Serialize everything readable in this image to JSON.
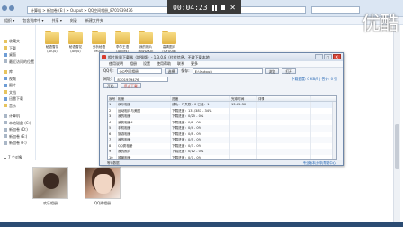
{
  "recorder": {
    "time": "00:04:23"
  },
  "watermark": "优酷",
  "explorer": {
    "address": "计算机 > 新加卷 (E:) > Output > QQ空间相册_8701939476",
    "search_placeholder": "",
    "toolbar": [
      "组织 ▾",
      "包含到库中 ▾",
      "共享 ▾",
      "刻录",
      "新建文件夹"
    ],
    "tree": [
      {
        "label": "收藏夹",
        "icon": "star-icon",
        "group": true
      },
      {
        "label": "下载",
        "icon": "folder-icon"
      },
      {
        "label": "桌面",
        "icon": "desktop-icon"
      },
      {
        "label": "最近访问的位置",
        "icon": "recent-icon"
      },
      {
        "label": "库",
        "icon": "library-icon",
        "group": true
      },
      {
        "label": "视频",
        "icon": "video-icon"
      },
      {
        "label": "图片",
        "icon": "picture-icon"
      },
      {
        "label": "文档",
        "icon": "document-icon"
      },
      {
        "label": "迅雷下载",
        "icon": "download-icon"
      },
      {
        "label": "音乐",
        "icon": "music-icon"
      },
      {
        "label": "计算机",
        "icon": "computer-icon",
        "group": true
      },
      {
        "label": "本地磁盘 (C:)",
        "icon": "drive-icon"
      },
      {
        "label": "新加卷 (D:)",
        "icon": "drive-icon"
      },
      {
        "label": "新加卷 (E:)",
        "icon": "drive-icon"
      },
      {
        "label": "新加卷 (F:)",
        "icon": "drive-icon"
      }
    ],
    "folders": [
      "秘语雪花(AIQu)",
      "秘语雪花(AIQu)",
      "分析秘语(Mulgi)",
      "李尔王语(Aqlies)",
      "我的相片(KWDIKx)",
      "高清图片(QYUUq)"
    ],
    "items_count": "7 个对象",
    "thumbnails": [
      {
        "label": "欢乐相册"
      },
      {
        "label": "QQ秀相册"
      }
    ]
  },
  "dialog": {
    "title": "相片批量下载器（增强版）- 1.3.0.8（付付信息，不敢下载本地）",
    "controls": [
      "_",
      "□",
      "X"
    ],
    "menu": [
      "使用说明",
      "相册",
      "设置",
      "使用帮助",
      "联系",
      "更多"
    ],
    "form": {
      "label_qq": "QQ号:",
      "qq_value": "QQ空间相册",
      "btn_select": "选择",
      "label_path": "保存:",
      "path_value": "E:\\Output\\",
      "btn_view": "浏览",
      "btn_open": "打开",
      "label_url": "网址:",
      "url_value": "8701939476",
      "status": "下载速度: 0 KB/S | 合计: 0 张"
    },
    "buttons": [
      "开始",
      "停止下载"
    ],
    "table": {
      "headers": [
        "序号",
        "相册",
        "进度",
        "完成时间",
        "详情"
      ],
      "rows": [
        [
          "1",
          "欢乐相册",
          "成功：7 失败：0 已经：1",
          "13:35:30",
          ""
        ],
        [
          "2",
          "运动相片与美图",
          "下载进度：131/387 - 34%",
          "",
          ""
        ],
        [
          "3",
          "我的相册",
          "下载进度：0/25 - 0%",
          "",
          ""
        ],
        [
          "4",
          "我的相册4",
          "下载进度：0/6 - 0%",
          "",
          ""
        ],
        [
          "5",
          "手机相册",
          "下载进度：0/4 - 0%",
          "",
          ""
        ],
        [
          "6",
          "旅游相册",
          "下载进度：0/8 - 0%",
          "",
          ""
        ],
        [
          "7",
          "我的相册",
          "下载进度：0/5 - 0%",
          "",
          ""
        ],
        [
          "8",
          "QQ秀相册",
          "下载进度：0/3 - 0%",
          "",
          ""
        ],
        [
          "9",
          "我的照片",
          "下载进度：0/12 - 0%",
          "",
          ""
        ],
        [
          "10",
          "风景相册",
          "下载进度：0/7 - 0%",
          "",
          ""
        ]
      ]
    },
    "status_left": "等待数据",
    "status_right": "专业版本|分享|帮助中心"
  }
}
